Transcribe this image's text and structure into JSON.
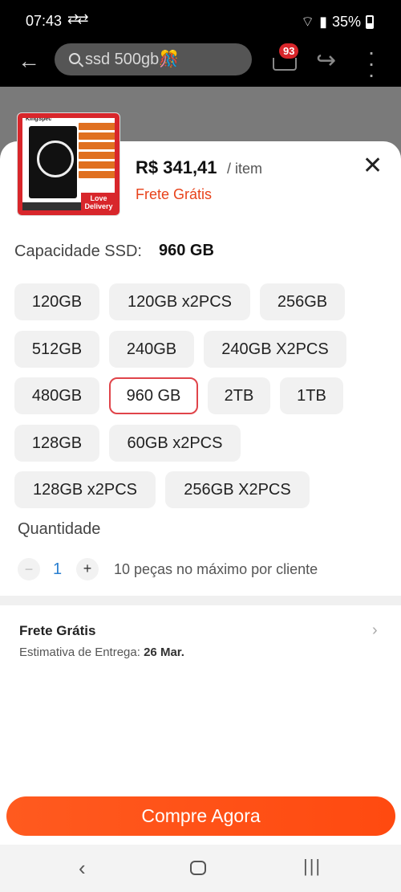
{
  "status": {
    "time": "07:43",
    "sync": "⇄⇄",
    "battery": "35%"
  },
  "search": {
    "query": "ssd 500gb🎊"
  },
  "cart": {
    "badge": "93"
  },
  "product": {
    "price": "R$ 341,41",
    "per_item": "/ item",
    "shipping": "Frete Grátis",
    "thumb_badge": "Love Delivery",
    "thumb_brand": "KingSpec"
  },
  "capacity": {
    "label": "Capacidade SSD:",
    "selected": "960 GB"
  },
  "options": [
    "120GB",
    "120GB x2PCS",
    "256GB",
    "512GB",
    "240GB",
    "240GB X2PCS",
    "480GB",
    "960 GB",
    "2TB",
    "1TB",
    "128GB",
    "60GB x2PCS",
    "128GB x2PCS",
    "256GB X2PCS"
  ],
  "quantity": {
    "label": "Quantidade",
    "minus": "−",
    "value": "1",
    "plus": "+",
    "note": "10 peças no máximo por cliente"
  },
  "shipping": {
    "title": "Frete Grátis",
    "estimate_label": "Estimativa de Entrega:",
    "estimate_date": "26 Mar."
  },
  "buy": {
    "label": "Compre Agora"
  },
  "colors": {
    "accent": "#ff4a10",
    "selected_border": "#e0444a",
    "shipping_text": "#e8421a",
    "qty_value": "#2a7fd0"
  }
}
